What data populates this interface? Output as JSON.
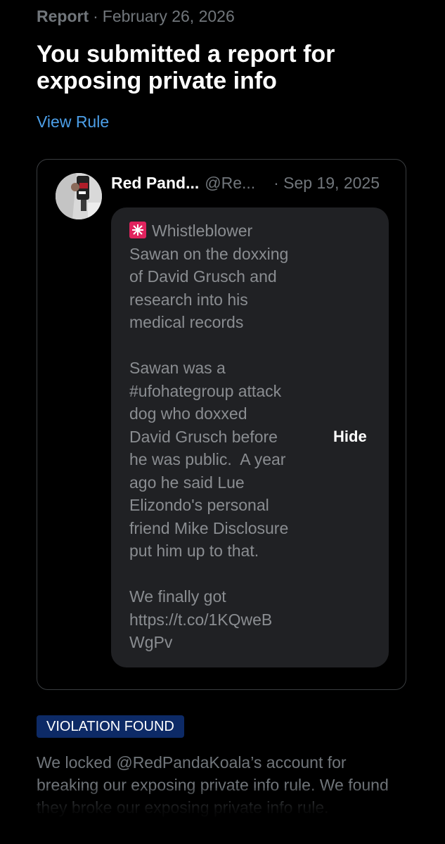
{
  "header": {
    "report_label": "Report",
    "separator": "·",
    "date": "February 26, 2026",
    "title": "You submitted a report for exposing private info",
    "view_rule_link": "View Rule"
  },
  "post": {
    "author_name": "Red Pand...",
    "author_handle": "@Re...",
    "date": "· Sep 19, 2025",
    "siren_icon": "police-siren-emoji",
    "text": "Whistleblower\nSawan on the doxxing\nof David Grusch and\nresearch into his\nmedical records\n\nSawan was a\n#ufohategroup attack\ndog who doxxed\nDavid Grusch before\nhe was public.  A year\nago he said Lue\nElizondo's personal\nfriend Mike Disclosure\nput him up to that.\n\nWe finally got\nhttps://t.co/1KQweB\nWgPv",
    "hide_button": "Hide"
  },
  "result": {
    "badge": "VIOLATION FOUND",
    "description": "We locked @RedPandaKoala’s account for breaking our exposing private info rule. We found they broke our exposing private info rule."
  },
  "colors": {
    "background": "#000000",
    "muted_text": "#71767b",
    "link": "#4c9fe8",
    "badge_bg": "#0d2a66",
    "bubble_bg": "#202124",
    "siren": "#e0245e"
  }
}
